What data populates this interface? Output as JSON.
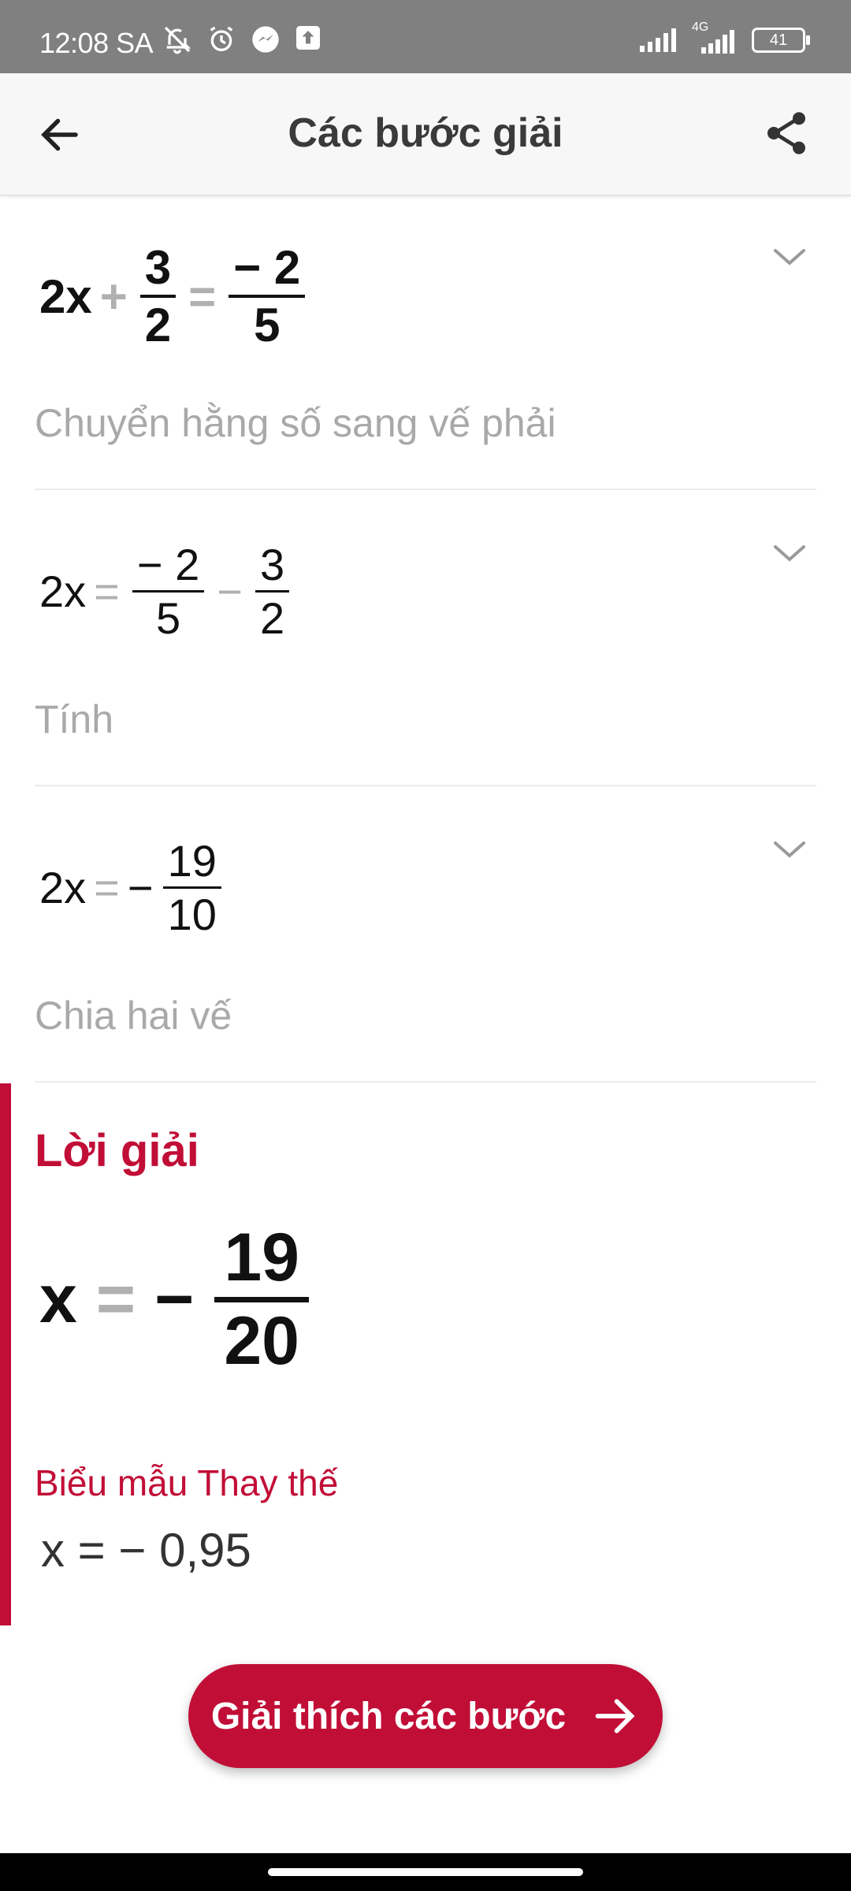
{
  "status_bar": {
    "time": "12:08 SA",
    "network": "4G",
    "battery": "41",
    "icons": [
      "bell-off-icon",
      "alarm-icon",
      "messenger-icon",
      "upload-icon",
      "signal-icon",
      "signal-4g-icon",
      "battery-icon"
    ]
  },
  "app_bar": {
    "title": "Các bước giải",
    "back_icon": "arrow-left-icon",
    "share_icon": "share-icon"
  },
  "steps": [
    {
      "equation": {
        "lhs": "2x",
        "op1": "+",
        "frac1_num": "3",
        "frac1_den": "2",
        "op2": "=",
        "frac2_num": "− 2",
        "frac2_den": "5"
      },
      "description": "Chuyển hằng số sang vế phải"
    },
    {
      "equation": {
        "lhs": "2x",
        "op1": "=",
        "frac1_num": "− 2",
        "frac1_den": "5",
        "op2": "−",
        "frac2_num": "3",
        "frac2_den": "2"
      },
      "description": "Tính"
    },
    {
      "equation": {
        "lhs": "2x",
        "op1": "=",
        "sign": "−",
        "frac1_num": "19",
        "frac1_den": "10"
      },
      "description": "Chia hai vế"
    }
  ],
  "solution": {
    "title": "Lời giải",
    "lhs": "x",
    "op": "=",
    "sign": "−",
    "num": "19",
    "den": "20",
    "alt_title": "Biểu mẫu Thay thế",
    "alt_value": "x = − 0,95"
  },
  "explain_button": {
    "label": "Giải thích các bước",
    "icon": "arrow-right-icon"
  },
  "colors": {
    "accent": "#c10e37",
    "muted": "#a9a9a9",
    "status_bar": "#808080"
  }
}
